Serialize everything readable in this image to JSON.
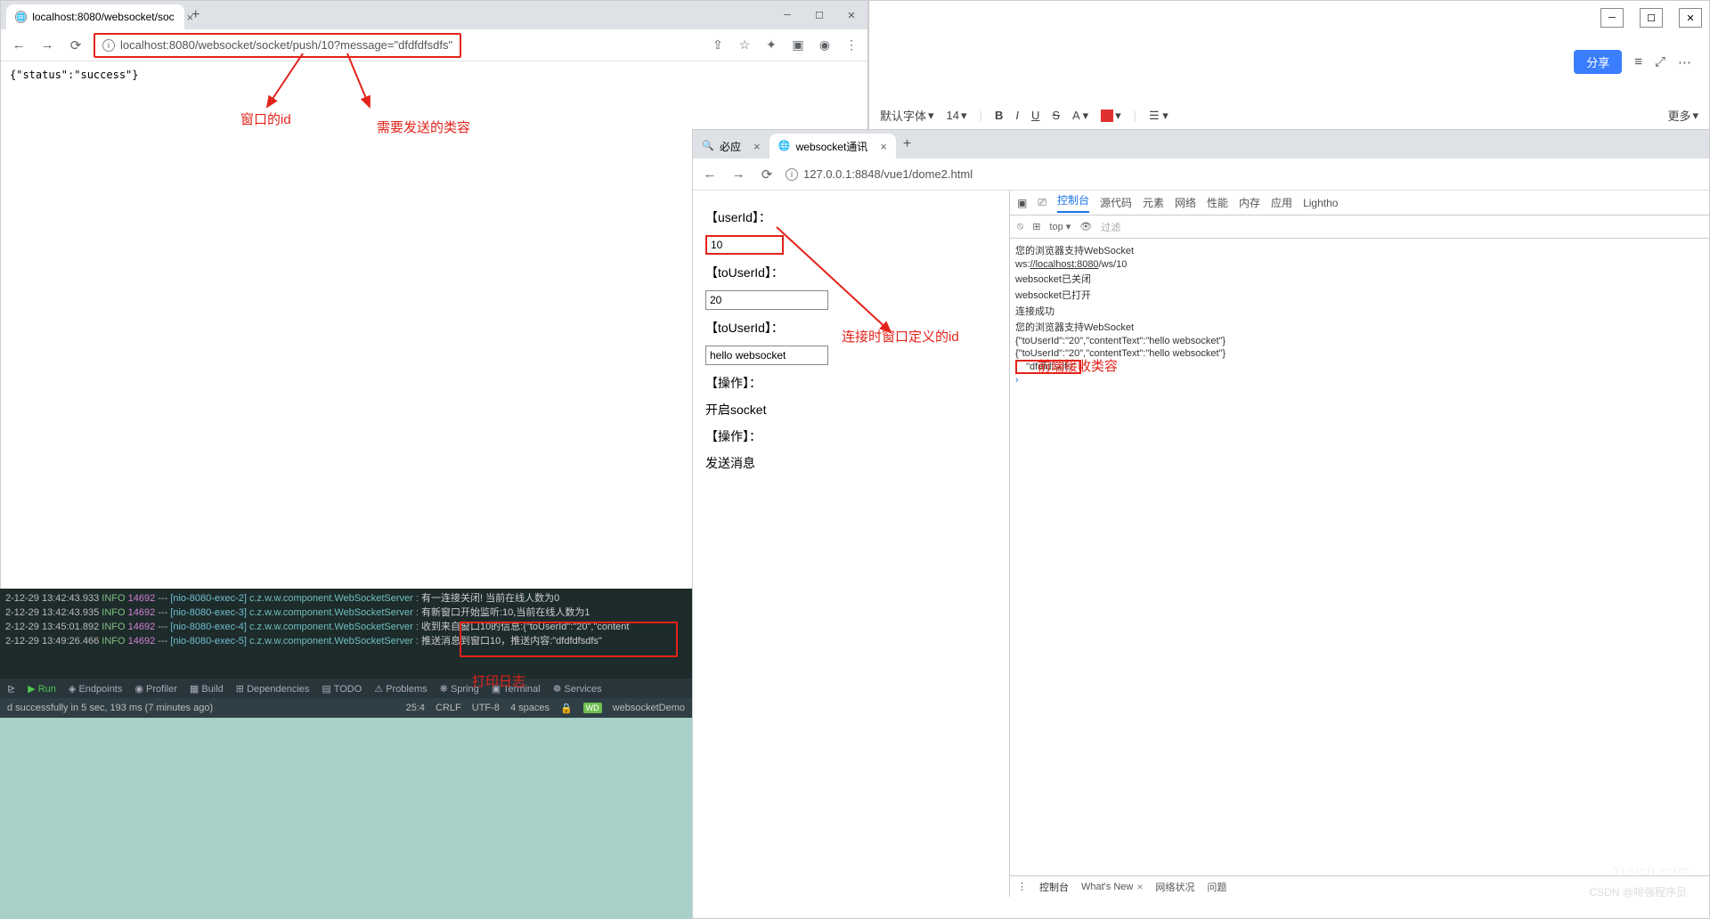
{
  "chrome1": {
    "tab_title": "localhost:8080/websocket/soc",
    "url": "localhost:8080/websocket/socket/push/10?message=\"dfdfdfsdfs\"",
    "response": "{\"status\":\"success\"}"
  },
  "annotations": {
    "win_id": "窗口的id",
    "send_content": "需要发送的类容",
    "conn_id": "连接时窗口定义的id",
    "front_recv": "前端接收类容",
    "print_log": "打印日志"
  },
  "doceditor": {
    "share": "分享",
    "font": "默认字体",
    "size": "14",
    "bold": "B",
    "italic": "I",
    "underline": "U",
    "strike": "S",
    "more": "更多"
  },
  "chrome2": {
    "tab1": "必应",
    "tab2": "websocket通讯",
    "url": "127.0.0.1:8848/vue1/dome2.html",
    "labels": {
      "userId": "【userId】：",
      "toUserId": "【toUserId】：",
      "toUserId2": "【toUserId】：",
      "op": "【操作】：",
      "open_socket": "开启socket",
      "op2": "【操作】：",
      "send_msg": "发送消息"
    },
    "values": {
      "userId": "10",
      "toUserId": "20",
      "content": "hello websocket"
    },
    "devtools": {
      "tabs": [
        "控制台",
        "源代码",
        "元素",
        "网络",
        "性能",
        "内存",
        "应用",
        "Lightho"
      ],
      "tools": {
        "top": "top",
        "filter": "过滤"
      },
      "console": [
        "您的浏览器支持WebSocket",
        "ws://localhost:8080/ws/10",
        "websocket已关闭",
        "websocket已打开",
        "连接成功",
        "您的浏览器支持WebSocket",
        "{\"toUserId\":\"20\",\"contentText\":\"hello websocket\"}",
        "{\"toUserId\":\"20\",\"contentText\":\"hello websocket\"}",
        "  \"dfdfdfsdfs\""
      ],
      "bottom": [
        "控制台",
        "What's New",
        "网络状况",
        "问题"
      ]
    }
  },
  "ide": {
    "logs": [
      {
        "ts": "2-12-29 13:42:43.933",
        "lvl": "INFO",
        "pid": "14692",
        "thr": "[nio-8080-exec-2]",
        "cls": "c.z.w.w.component.WebSocketServer",
        "msg": "有一连接关闭! 当前在线人数为0"
      },
      {
        "ts": "2-12-29 13:42:43.935",
        "lvl": "INFO",
        "pid": "14692",
        "thr": "[nio-8080-exec-3]",
        "cls": "c.z.w.w.component.WebSocketServer",
        "msg": "有新窗口开始监听:10,当前在线人数为1"
      },
      {
        "ts": "2-12-29 13:45:01.892",
        "lvl": "INFO",
        "pid": "14692",
        "thr": "[nio-8080-exec-4]",
        "cls": "c.z.w.w.component.WebSocketServer",
        "msg": "收到来自窗口10的信息:{\"toUserId\":\"20\",\"content"
      },
      {
        "ts": "2-12-29 13:49:26.466",
        "lvl": "INFO",
        "pid": "14692",
        "thr": "[nio-8080-exec-5]",
        "cls": "c.z.w.w.component.WebSocketServer",
        "msg": "推送消息到窗口10，推送内容:\"dfdfdfsdfs\""
      }
    ],
    "toolbar": [
      "Run",
      "Endpoints",
      "Profiler",
      "Build",
      "Dependencies",
      "TODO",
      "Problems",
      "Spring",
      "Terminal",
      "Services"
    ],
    "status_left": "d successfully in 5 sec, 193 ms (7 minutes ago)",
    "status_right": {
      "pos": "25:4",
      "crlf": "CRLF",
      "enc": "UTF-8",
      "spaces": "4 spaces",
      "wd": "WD",
      "proj": "websocketDemo"
    }
  },
  "wm": {
    "brand": "Yuucn.com",
    "csdn": "CSDN @啡强程序员"
  }
}
